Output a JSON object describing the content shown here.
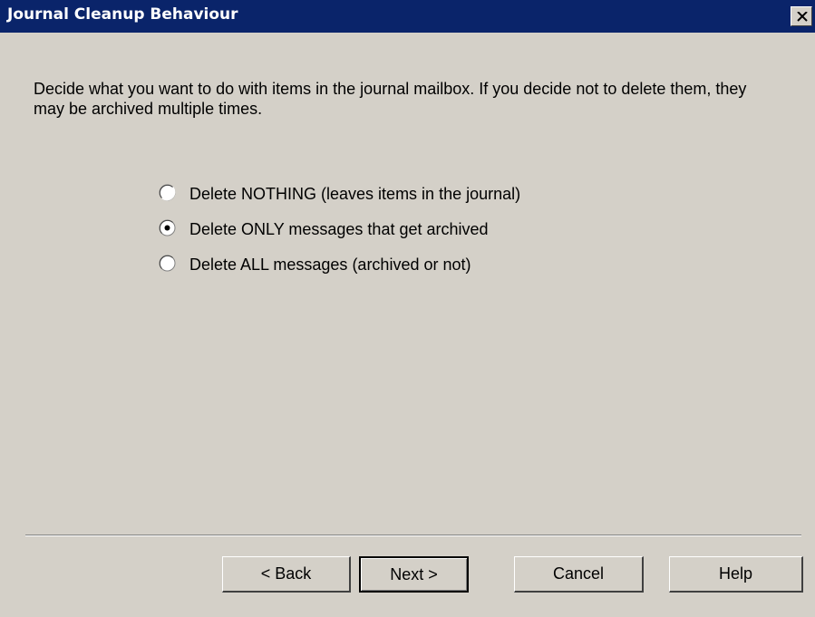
{
  "window": {
    "title": "Journal Cleanup Behaviour",
    "close_icon": "close-icon"
  },
  "description": "Decide what you want to do with items in the journal mailbox. If you decide not to delete them, they may be archived multiple times.",
  "options": [
    {
      "label": "Delete NOTHING (leaves items in the journal)",
      "selected": false
    },
    {
      "label": "Delete ONLY messages that get archived",
      "selected": true
    },
    {
      "label": "Delete ALL messages (archived or not)",
      "selected": false
    }
  ],
  "buttons": {
    "back": "< Back",
    "next": "Next >",
    "cancel": "Cancel",
    "help": "Help"
  },
  "colors": {
    "titlebar": "#0a246a",
    "face": "#d4d0c8"
  }
}
